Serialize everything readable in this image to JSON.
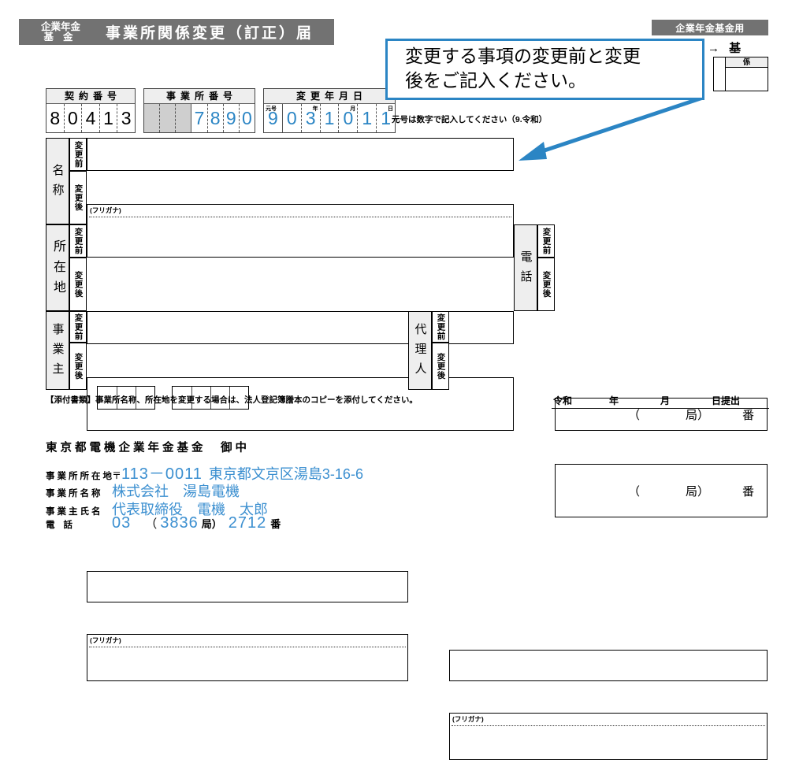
{
  "header": {
    "kikin_line1": "企業年金",
    "kikin_line2": "基金",
    "title": "事業所関係変更（訂正）届",
    "badge_right": "企業年金基金用",
    "arrow_ki": "→ 基",
    "mini_table_header": "係"
  },
  "callout": {
    "line1": "変更する事項の変更前と変更",
    "line2": "後をご記入ください。"
  },
  "number_boxes": {
    "contract": {
      "caption": "契約番号",
      "digits": [
        "8",
        "0",
        "4",
        "1",
        "3"
      ]
    },
    "office": {
      "caption": "事業所番号",
      "gray_cells": 3,
      "digits": [
        "7",
        "8",
        "9",
        "0"
      ]
    },
    "change_date": {
      "caption": "変更年月日",
      "sub_labels": [
        "元号",
        "年",
        "月",
        "日"
      ],
      "digits": [
        "9",
        "0",
        "3",
        "1",
        "0",
        "1",
        "1"
      ]
    },
    "gengo_note": "元号は数字で記入してください（9.令和）"
  },
  "table": {
    "rows": {
      "meisho": {
        "label": "名称",
        "before": "変更前",
        "after": "変更後",
        "furigana": "(フリガナ)"
      },
      "shozaichi": {
        "label": "所在地",
        "before": "変更前",
        "after": "変更後",
        "zip_left_cells": 3,
        "zip_right_cells": 4,
        "zip_hyphen": "-"
      },
      "jigyonushi": {
        "label": "事業主",
        "before": "変更前",
        "after": "変更後",
        "furigana": "(フリガナ)"
      },
      "denwa": {
        "label": "電話",
        "before": "変更前",
        "after": "変更後",
        "paren_open": "（",
        "kyoku": "局）",
        "ban": "番"
      },
      "dairinin": {
        "label": "代理人",
        "before": "変更前",
        "after": "変更後",
        "furigana": "(フリガナ)"
      }
    }
  },
  "footer": {
    "attachment_note": "【添付書類】事業所名称、所在地を変更する場合は、法人登記簿謄本のコピーを添付してください。",
    "submit": {
      "era": "令和",
      "year": "年",
      "month": "月",
      "day": "日提出"
    },
    "fund_name": "東京都電機企業年金基金　御中",
    "applicant": {
      "address_label": "事業所所在地",
      "address_zip_mark": "〒",
      "address_zip": "113－0011",
      "address_value": "東京都文京区湯島3-16-6",
      "name_label": "事業所名称",
      "name_value": "株式会社　湯島電機",
      "owner_label": "事業主氏名",
      "owner_value": "代表取締役　電機　太郎",
      "tel_label": "電話",
      "tel_area": "03",
      "tel_paren_open": "（",
      "tel_exchange": "3836",
      "tel_kyoku": "局）",
      "tel_number": "2712",
      "tel_ban": "番"
    }
  },
  "colors": {
    "header_gray": "#727272",
    "accent_blue": "#2b85c4",
    "value_blue": "#3b8fd0"
  }
}
